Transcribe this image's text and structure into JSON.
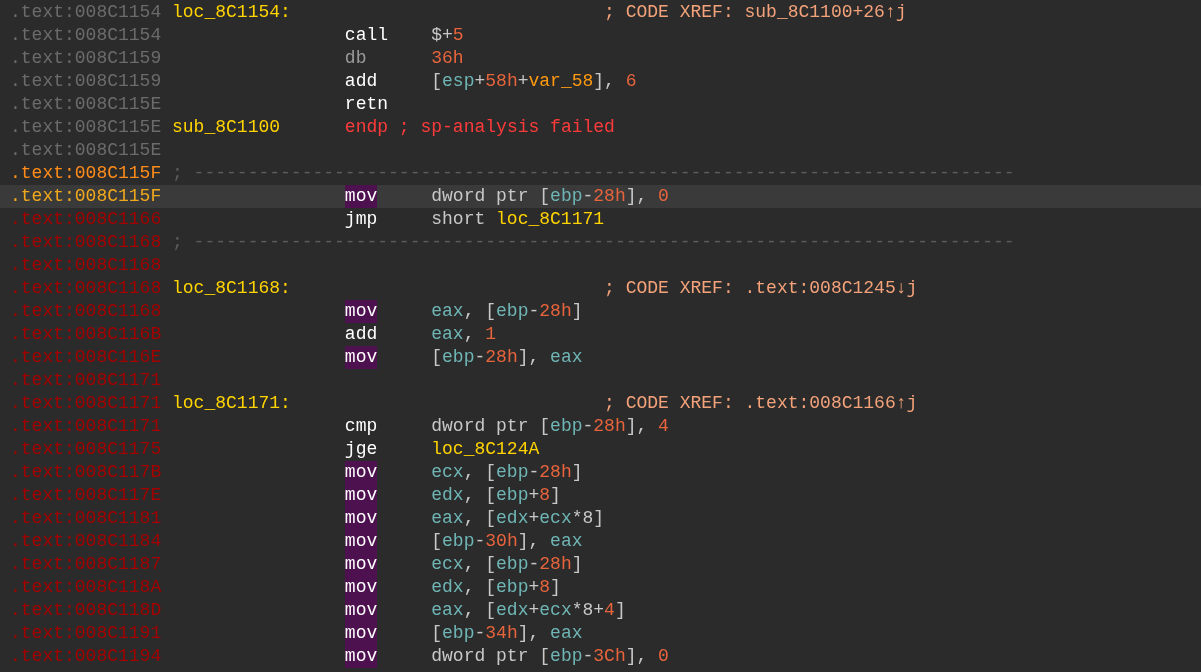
{
  "listing": [
    {
      "kind": "label",
      "color": "#6b6b6b",
      "selected": false,
      "address": ".text:008C1154",
      "label": "loc_8C1154:",
      "comment": "; CODE XREF: sub_8C1100+26↑j"
    },
    {
      "kind": "instr",
      "color": "#6b6b6b",
      "selected": false,
      "address": ".text:008C1154",
      "mnemonic": "call",
      "highlighted": false,
      "operands": [
        {
          "kind": "plain",
          "t": "$+"
        },
        {
          "kind": "num",
          "t": "5"
        }
      ]
    },
    {
      "kind": "data",
      "color": "#6b6b6b",
      "selected": false,
      "address": ".text:008C1159",
      "mnemonic": "db",
      "highlighted": false,
      "operands": [
        {
          "kind": "num",
          "t": "36h"
        }
      ]
    },
    {
      "kind": "instr",
      "color": "#6b6b6b",
      "selected": false,
      "address": ".text:008C1159",
      "mnemonic": "add",
      "highlighted": false,
      "operands": [
        {
          "kind": "punct",
          "t": "["
        },
        {
          "kind": "reg",
          "t": "esp"
        },
        {
          "kind": "punct",
          "t": "+"
        },
        {
          "kind": "num",
          "t": "58h"
        },
        {
          "kind": "punct",
          "t": "+"
        },
        {
          "kind": "var",
          "t": "var_58"
        },
        {
          "kind": "punct",
          "t": "], "
        },
        {
          "kind": "num",
          "t": "6"
        }
      ]
    },
    {
      "kind": "instr",
      "color": "#6b6b6b",
      "selected": false,
      "address": ".text:008C115E",
      "mnemonic": "retn",
      "highlighted": false
    },
    {
      "kind": "end",
      "color": "#6b6b6b",
      "selected": false,
      "address": ".text:008C115E",
      "label": "sub_8C1100",
      "mnemonic": "endp",
      "note": "; sp-analysis failed"
    },
    {
      "kind": "blank",
      "color": "#6b6b6b",
      "selected": false,
      "address": ".text:008C115E"
    },
    {
      "kind": "separator",
      "color": "#ff8c1a",
      "selected": false,
      "address": ".text:008C115F",
      "rule": "; ----------------------------------------------------------------------------"
    },
    {
      "kind": "instr",
      "color": "#f0a81c",
      "selected": true,
      "address": ".text:008C115F",
      "mnemonic": "mov",
      "highlighted": true,
      "operands": [
        {
          "kind": "plain",
          "t": "dword ptr ["
        },
        {
          "kind": "reg",
          "t": "ebp"
        },
        {
          "kind": "punct",
          "t": "-"
        },
        {
          "kind": "num",
          "t": "28h"
        },
        {
          "kind": "punct",
          "t": "], "
        },
        {
          "kind": "num",
          "t": "0"
        }
      ]
    },
    {
      "kind": "instr",
      "color": "#a30000",
      "selected": false,
      "address": ".text:008C1166",
      "mnemonic": "jmp",
      "highlighted": false,
      "operands": [
        {
          "kind": "plain",
          "t": "short "
        },
        {
          "kind": "name",
          "t": "loc_8C1171"
        }
      ]
    },
    {
      "kind": "separator",
      "color": "#a30000",
      "selected": false,
      "address": ".text:008C1168",
      "rule": "; ----------------------------------------------------------------------------"
    },
    {
      "kind": "blank",
      "color": "#a30000",
      "selected": false,
      "address": ".text:008C1168"
    },
    {
      "kind": "label",
      "color": "#a30000",
      "selected": false,
      "address": ".text:008C1168",
      "label": "loc_8C1168:",
      "comment": "; CODE XREF: .text:008C1245↓j"
    },
    {
      "kind": "instr",
      "color": "#a30000",
      "selected": false,
      "address": ".text:008C1168",
      "mnemonic": "mov",
      "highlighted": true,
      "operands": [
        {
          "kind": "reg",
          "t": "eax"
        },
        {
          "kind": "punct",
          "t": ", ["
        },
        {
          "kind": "reg",
          "t": "ebp"
        },
        {
          "kind": "punct",
          "t": "-"
        },
        {
          "kind": "num",
          "t": "28h"
        },
        {
          "kind": "punct",
          "t": "]"
        }
      ]
    },
    {
      "kind": "instr",
      "color": "#a30000",
      "selected": false,
      "address": ".text:008C116B",
      "mnemonic": "add",
      "highlighted": false,
      "operands": [
        {
          "kind": "reg",
          "t": "eax"
        },
        {
          "kind": "punct",
          "t": ", "
        },
        {
          "kind": "num",
          "t": "1"
        }
      ]
    },
    {
      "kind": "instr",
      "color": "#a30000",
      "selected": false,
      "address": ".text:008C116E",
      "mnemonic": "mov",
      "highlighted": true,
      "operands": [
        {
          "kind": "punct",
          "t": "["
        },
        {
          "kind": "reg",
          "t": "ebp"
        },
        {
          "kind": "punct",
          "t": "-"
        },
        {
          "kind": "num",
          "t": "28h"
        },
        {
          "kind": "punct",
          "t": "], "
        },
        {
          "kind": "reg",
          "t": "eax"
        }
      ]
    },
    {
      "kind": "blank",
      "color": "#a30000",
      "selected": false,
      "address": ".text:008C1171"
    },
    {
      "kind": "label",
      "color": "#a30000",
      "selected": false,
      "address": ".text:008C1171",
      "label": "loc_8C1171:",
      "comment": "; CODE XREF: .text:008C1166↑j"
    },
    {
      "kind": "instr",
      "color": "#a30000",
      "selected": false,
      "address": ".text:008C1171",
      "mnemonic": "cmp",
      "highlighted": false,
      "operands": [
        {
          "kind": "plain",
          "t": "dword ptr ["
        },
        {
          "kind": "reg",
          "t": "ebp"
        },
        {
          "kind": "punct",
          "t": "-"
        },
        {
          "kind": "num",
          "t": "28h"
        },
        {
          "kind": "punct",
          "t": "], "
        },
        {
          "kind": "num",
          "t": "4"
        }
      ]
    },
    {
      "kind": "instr",
      "color": "#a30000",
      "selected": false,
      "address": ".text:008C1175",
      "mnemonic": "jge",
      "highlighted": false,
      "operands": [
        {
          "kind": "name",
          "t": "loc_8C124A"
        }
      ]
    },
    {
      "kind": "instr",
      "color": "#a30000",
      "selected": false,
      "address": ".text:008C117B",
      "mnemonic": "mov",
      "highlighted": true,
      "operands": [
        {
          "kind": "reg",
          "t": "ecx"
        },
        {
          "kind": "punct",
          "t": ", ["
        },
        {
          "kind": "reg",
          "t": "ebp"
        },
        {
          "kind": "punct",
          "t": "-"
        },
        {
          "kind": "num",
          "t": "28h"
        },
        {
          "kind": "punct",
          "t": "]"
        }
      ]
    },
    {
      "kind": "instr",
      "color": "#a30000",
      "selected": false,
      "address": ".text:008C117E",
      "mnemonic": "mov",
      "highlighted": true,
      "operands": [
        {
          "kind": "reg",
          "t": "edx"
        },
        {
          "kind": "punct",
          "t": ", ["
        },
        {
          "kind": "reg",
          "t": "ebp"
        },
        {
          "kind": "punct",
          "t": "+"
        },
        {
          "kind": "num",
          "t": "8"
        },
        {
          "kind": "punct",
          "t": "]"
        }
      ]
    },
    {
      "kind": "instr",
      "color": "#a30000",
      "selected": false,
      "address": ".text:008C1181",
      "mnemonic": "mov",
      "highlighted": true,
      "operands": [
        {
          "kind": "reg",
          "t": "eax"
        },
        {
          "kind": "punct",
          "t": ", ["
        },
        {
          "kind": "reg",
          "t": "edx"
        },
        {
          "kind": "punct",
          "t": "+"
        },
        {
          "kind": "reg",
          "t": "ecx"
        },
        {
          "kind": "punct",
          "t": "*8]"
        }
      ]
    },
    {
      "kind": "instr",
      "color": "#a30000",
      "selected": false,
      "address": ".text:008C1184",
      "mnemonic": "mov",
      "highlighted": true,
      "operands": [
        {
          "kind": "punct",
          "t": "["
        },
        {
          "kind": "reg",
          "t": "ebp"
        },
        {
          "kind": "punct",
          "t": "-"
        },
        {
          "kind": "num",
          "t": "30h"
        },
        {
          "kind": "punct",
          "t": "], "
        },
        {
          "kind": "reg",
          "t": "eax"
        }
      ]
    },
    {
      "kind": "instr",
      "color": "#a30000",
      "selected": false,
      "address": ".text:008C1187",
      "mnemonic": "mov",
      "highlighted": true,
      "operands": [
        {
          "kind": "reg",
          "t": "ecx"
        },
        {
          "kind": "punct",
          "t": ", ["
        },
        {
          "kind": "reg",
          "t": "ebp"
        },
        {
          "kind": "punct",
          "t": "-"
        },
        {
          "kind": "num",
          "t": "28h"
        },
        {
          "kind": "punct",
          "t": "]"
        }
      ]
    },
    {
      "kind": "instr",
      "color": "#a30000",
      "selected": false,
      "address": ".text:008C118A",
      "mnemonic": "mov",
      "highlighted": true,
      "operands": [
        {
          "kind": "reg",
          "t": "edx"
        },
        {
          "kind": "punct",
          "t": ", ["
        },
        {
          "kind": "reg",
          "t": "ebp"
        },
        {
          "kind": "punct",
          "t": "+"
        },
        {
          "kind": "num",
          "t": "8"
        },
        {
          "kind": "punct",
          "t": "]"
        }
      ]
    },
    {
      "kind": "instr",
      "color": "#a30000",
      "selected": false,
      "address": ".text:008C118D",
      "mnemonic": "mov",
      "highlighted": true,
      "operands": [
        {
          "kind": "reg",
          "t": "eax"
        },
        {
          "kind": "punct",
          "t": ", ["
        },
        {
          "kind": "reg",
          "t": "edx"
        },
        {
          "kind": "punct",
          "t": "+"
        },
        {
          "kind": "reg",
          "t": "ecx"
        },
        {
          "kind": "punct",
          "t": "*8+"
        },
        {
          "kind": "num",
          "t": "4"
        },
        {
          "kind": "punct",
          "t": "]"
        }
      ]
    },
    {
      "kind": "instr",
      "color": "#a30000",
      "selected": false,
      "address": ".text:008C1191",
      "mnemonic": "mov",
      "highlighted": true,
      "operands": [
        {
          "kind": "punct",
          "t": "["
        },
        {
          "kind": "reg",
          "t": "ebp"
        },
        {
          "kind": "punct",
          "t": "-"
        },
        {
          "kind": "num",
          "t": "34h"
        },
        {
          "kind": "punct",
          "t": "], "
        },
        {
          "kind": "reg",
          "t": "eax"
        }
      ]
    },
    {
      "kind": "instr",
      "color": "#a30000",
      "selected": false,
      "address": ".text:008C1194",
      "mnemonic": "mov",
      "highlighted": true,
      "operands": [
        {
          "kind": "plain",
          "t": "dword ptr ["
        },
        {
          "kind": "reg",
          "t": "ebp"
        },
        {
          "kind": "punct",
          "t": "-"
        },
        {
          "kind": "num",
          "t": "3Ch"
        },
        {
          "kind": "punct",
          "t": "], "
        },
        {
          "kind": "num",
          "t": "0"
        }
      ]
    }
  ]
}
